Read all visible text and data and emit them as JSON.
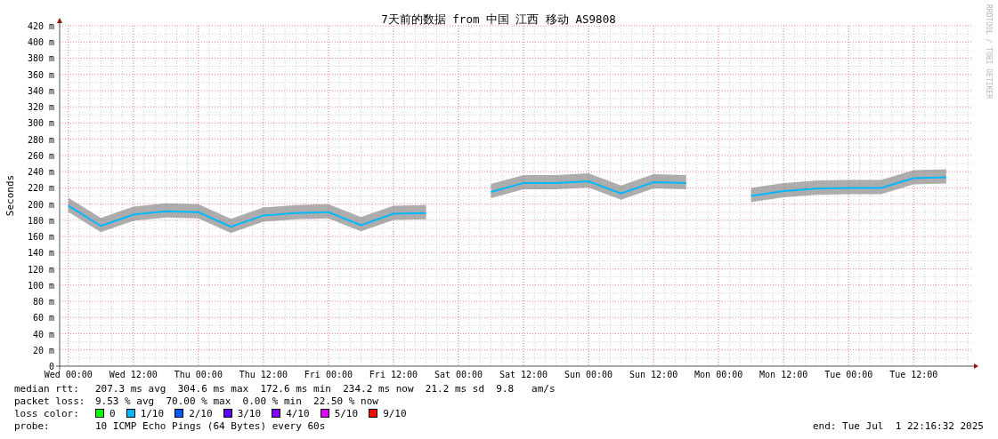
{
  "graph": {
    "credit": "RRDTOOL / TOBI OETIKER",
    "chart_data": {
      "type": "line",
      "title": "7天前的数据 from 中国 江西 移动 AS9808",
      "ylabel": "Seconds",
      "categories": [
        "Wed 00:00",
        null,
        "Wed 12:00",
        null,
        "Thu 00:00",
        null,
        "Thu 12:00",
        null,
        "Fri 00:00",
        null,
        "Fri 12:00",
        null,
        "Sat 00:00",
        null,
        "Sat 12:00",
        null,
        "Sun 00:00",
        null,
        "Sun 12:00",
        null,
        "Mon 00:00",
        null,
        "Mon 12:00",
        null,
        "Tue 00:00",
        null,
        "Tue 12:00",
        null
      ],
      "series": [
        {
          "color": "#00b8ff",
          "values": [
            198,
            173,
            187,
            191,
            190,
            172,
            186,
            189,
            190,
            174,
            188,
            189,
            null,
            215,
            226,
            226,
            228,
            213,
            227,
            226,
            null,
            210,
            216,
            219,
            220,
            220,
            232,
            233
          ]
        }
      ],
      "ylim": [
        0,
        420
      ],
      "grid": true,
      "yticks": [
        {
          "value": 0,
          "label": "0"
        },
        {
          "value": 20,
          "label": "20 m"
        },
        {
          "value": 40,
          "label": "40 m"
        },
        {
          "value": 60,
          "label": "60 m"
        },
        {
          "value": 80,
          "label": "80 m"
        },
        {
          "value": 100,
          "label": "100 m"
        },
        {
          "value": 120,
          "label": "120 m"
        },
        {
          "value": 140,
          "label": "140 m"
        },
        {
          "value": 160,
          "label": "160 m"
        },
        {
          "value": 180,
          "label": "180 m"
        },
        {
          "value": 200,
          "label": "200 m"
        },
        {
          "value": 220,
          "label": "220 m"
        },
        {
          "value": 240,
          "label": "240 m"
        },
        {
          "value": 260,
          "label": "260 m"
        },
        {
          "value": 280,
          "label": "280 m"
        },
        {
          "value": 300,
          "label": "300 m"
        },
        {
          "value": 320,
          "label": "320 m"
        },
        {
          "value": 340,
          "label": "340 m"
        },
        {
          "value": 360,
          "label": "360 m"
        },
        {
          "value": 380,
          "label": "380 m"
        },
        {
          "value": 400,
          "label": "400 m"
        },
        {
          "value": 420,
          "label": "420 m"
        }
      ]
    }
  },
  "stats": [
    {
      "label": "median rtt:",
      "value": "207.3 ms avg  304.6 ms max  172.6 ms min  234.2 ms now  21.2 ms sd  9.8   am/s"
    },
    {
      "label": "packet loss:",
      "value": "9.53 % avg  70.00 % max  0.00 % min  22.50 % now"
    }
  ],
  "loss_color": {
    "label": "loss color:",
    "items": [
      {
        "label": "0",
        "color": "#00ff00"
      },
      {
        "label": "1/10",
        "color": "#00b8ff"
      },
      {
        "label": "2/10",
        "color": "#0059ff"
      },
      {
        "label": "3/10",
        "color": "#5e00ff"
      },
      {
        "label": "4/10",
        "color": "#7e00ff"
      },
      {
        "label": "5/10",
        "color": "#dd00ff"
      },
      {
        "label": "9/10",
        "color": "#ff0000"
      }
    ]
  },
  "probe": {
    "label": "probe:",
    "value": "10 ICMP Echo Pings (64 Bytes) every 60s",
    "end": "end: Tue Jul  1 22:16:32 2025"
  }
}
